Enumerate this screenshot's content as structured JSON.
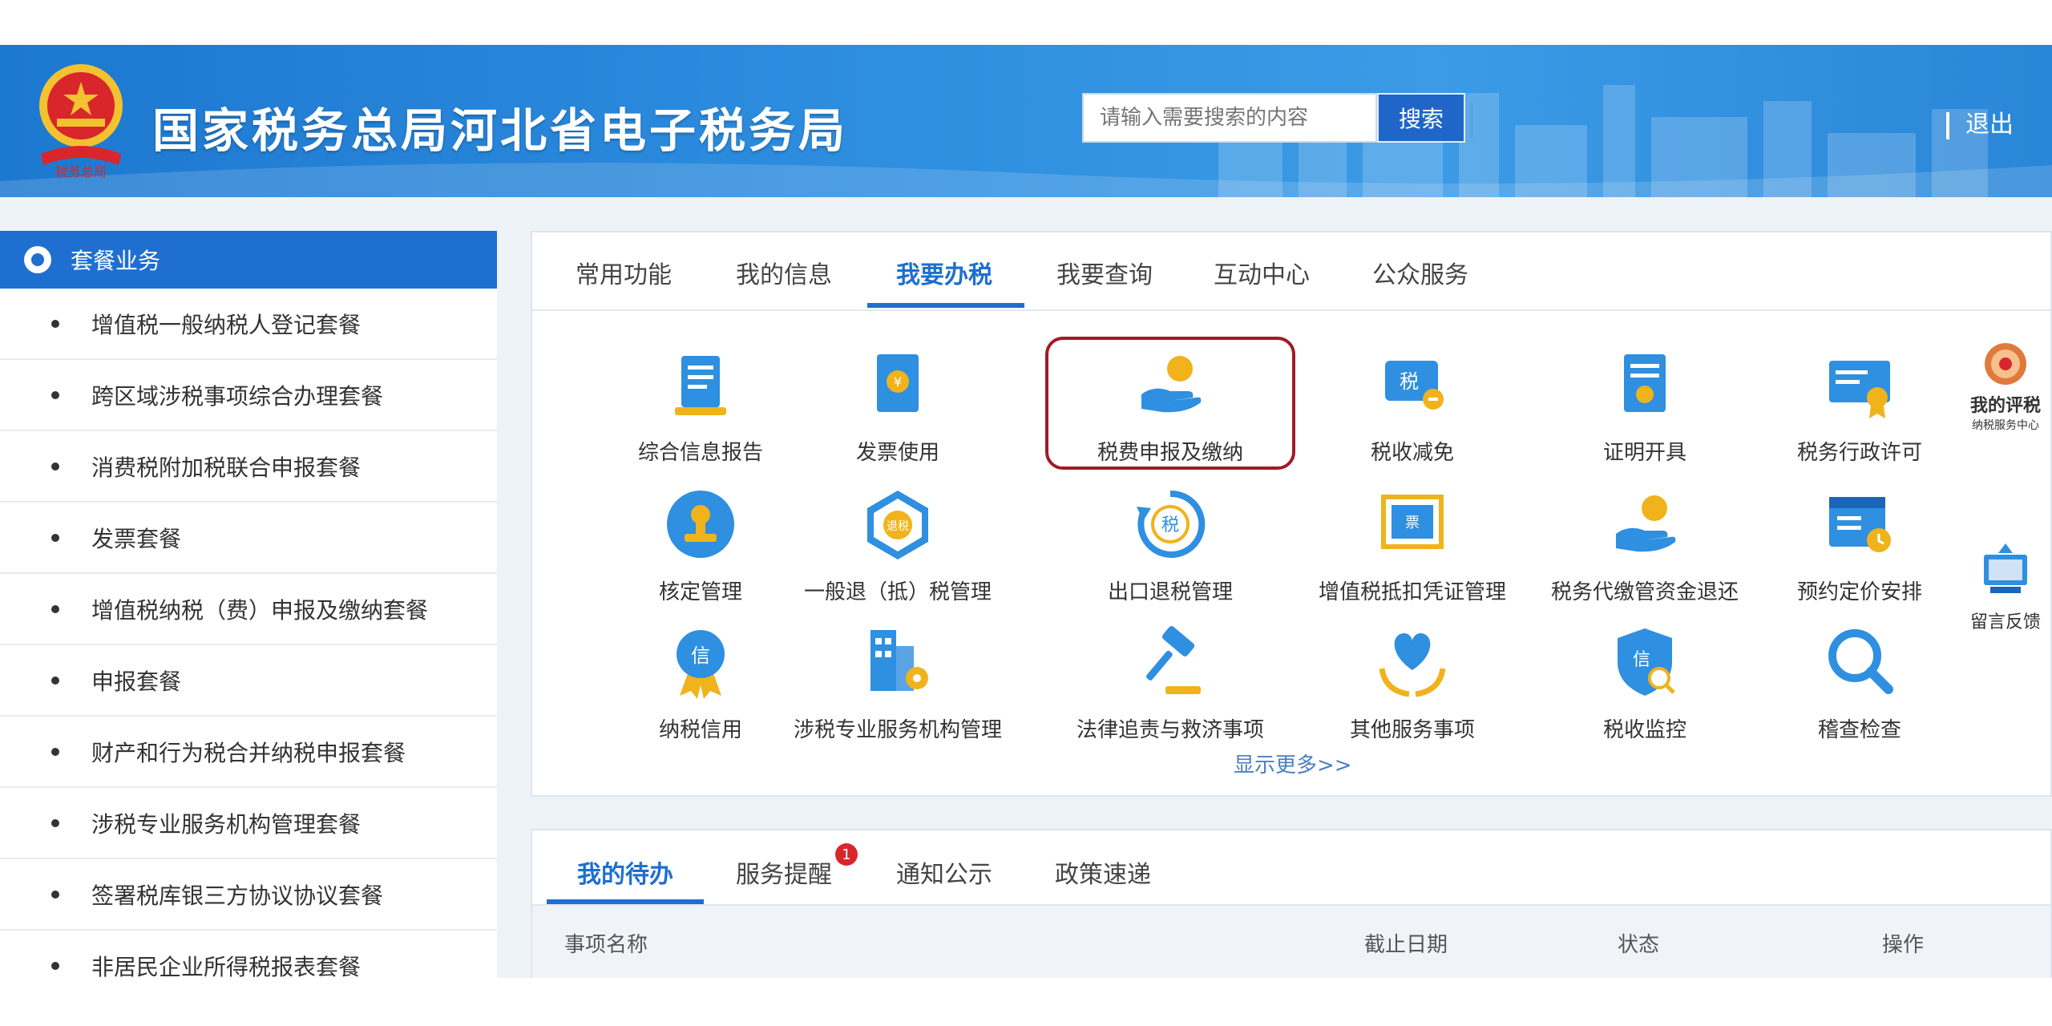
{
  "header": {
    "title": "国家税务总局河北省电子税务局",
    "emblem_text": "税务总局",
    "search_placeholder": "请输入需要搜索的内容",
    "search_button": "搜索",
    "logout": "退出"
  },
  "sidebar": {
    "title": "套餐业务",
    "items": [
      {
        "label": "增值税一般纳税人登记套餐"
      },
      {
        "label": "跨区域涉税事项综合办理套餐"
      },
      {
        "label": "消费税附加税联合申报套餐"
      },
      {
        "label": "发票套餐"
      },
      {
        "label": "增值税纳税（费）申报及缴纳套餐"
      },
      {
        "label": "申报套餐"
      },
      {
        "label": "财产和行为税合并纳税申报套餐"
      },
      {
        "label": "涉税专业服务机构管理套餐"
      },
      {
        "label": "签署税库银三方协议协议套餐"
      },
      {
        "label": "非居民企业所得税报表套餐"
      }
    ]
  },
  "main_tabs": [
    {
      "label": "常用功能"
    },
    {
      "label": "我的信息"
    },
    {
      "label": "我要办税"
    },
    {
      "label": "我要查询"
    },
    {
      "label": "互动中心"
    },
    {
      "label": "公众服务"
    }
  ],
  "services": [
    {
      "label": "综合信息报告",
      "icon": "report-icon"
    },
    {
      "label": "发票使用",
      "icon": "invoice-icon"
    },
    {
      "label": "税费申报及缴纳",
      "icon": "tax-payment-icon"
    },
    {
      "label": "税收减免",
      "icon": "tax-reduction-icon"
    },
    {
      "label": "证明开具",
      "icon": "certificate-icon"
    },
    {
      "label": "税务行政许可",
      "icon": "permit-icon"
    },
    {
      "label": "核定管理",
      "icon": "approval-stamp-icon"
    },
    {
      "label": "一般退（抵）税管理",
      "icon": "refund-icon"
    },
    {
      "label": "出口退税管理",
      "icon": "export-refund-icon"
    },
    {
      "label": "增值税抵扣凭证管理",
      "icon": "voucher-icon"
    },
    {
      "label": "税务代缴管资金退还",
      "icon": "fund-refund-icon"
    },
    {
      "label": "预约定价安排",
      "icon": "calendar-icon"
    },
    {
      "label": "纳税信用",
      "icon": "credit-icon"
    },
    {
      "label": "涉税专业服务机构管理",
      "icon": "agency-icon"
    },
    {
      "label": "法律追责与救济事项",
      "icon": "gavel-icon"
    },
    {
      "label": "其他服务事项",
      "icon": "heart-hands-icon"
    },
    {
      "label": "税收监控",
      "icon": "shield-search-icon"
    },
    {
      "label": "稽查检查",
      "icon": "magnifier-icon"
    }
  ],
  "more_link": "显示更多>>",
  "side_badges": [
    {
      "label": "我的评税",
      "sub": "纳税服务中心"
    },
    {
      "label": "留言反馈"
    }
  ],
  "bottom_tabs": [
    {
      "label": "我的待办"
    },
    {
      "label": "服务提醒"
    },
    {
      "label": "通知公示"
    },
    {
      "label": "政策速递"
    }
  ],
  "reminder_count": "1",
  "table_headers": {
    "name": "事项名称",
    "deadline": "截止日期",
    "status": "状态",
    "action": "操作"
  },
  "colors": {
    "brand_blue": "#1e6fd0",
    "highlight_red": "#a01a26",
    "icon_blue": "#2f8fe0",
    "icon_gold": "#f0b31c"
  }
}
